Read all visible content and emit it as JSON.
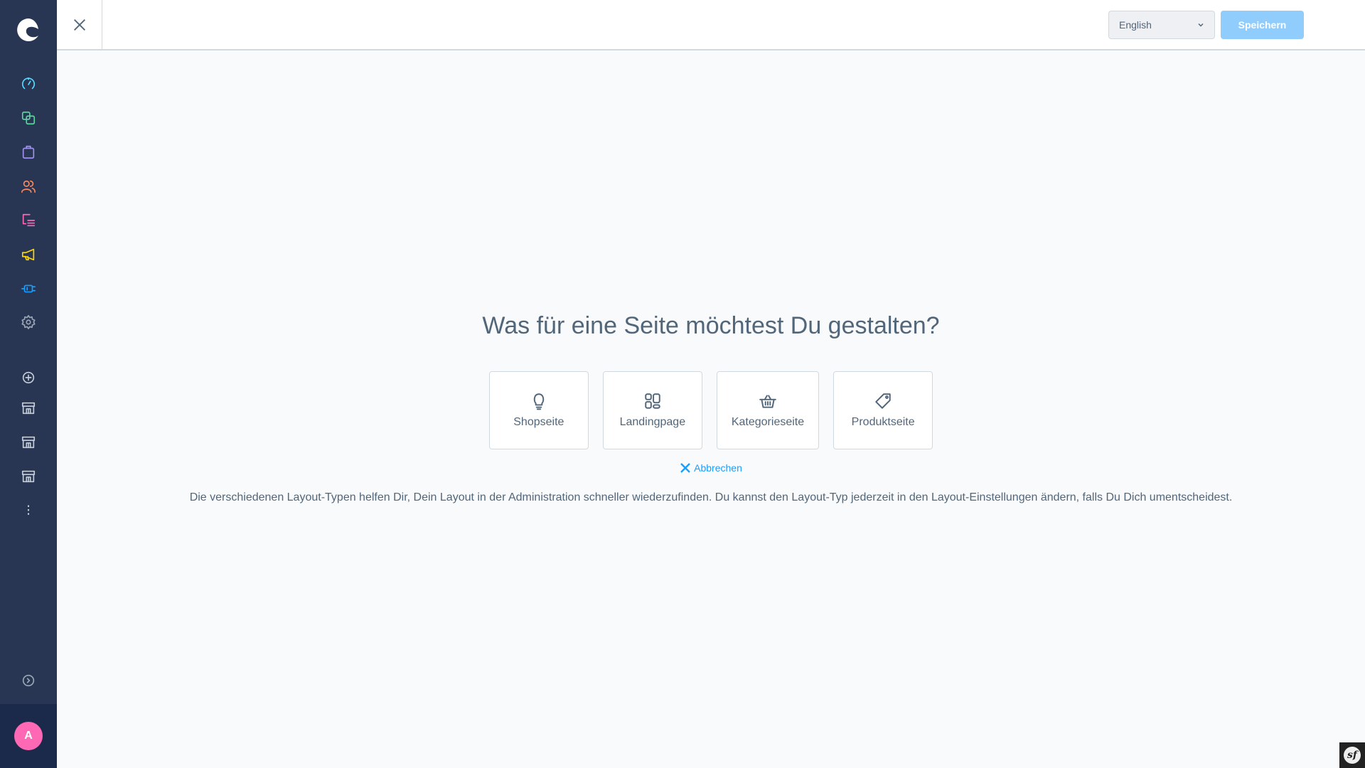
{
  "header": {
    "language": "English",
    "save_label": "Speichern"
  },
  "sidebar": {
    "items": [
      {
        "name": "dashboard",
        "color": "#57d9ff"
      },
      {
        "name": "catalogues",
        "color": "#57d99d"
      },
      {
        "name": "orders",
        "color": "#a092f0"
      },
      {
        "name": "customers",
        "color": "#f88962"
      },
      {
        "name": "content",
        "color": "#ff68b4"
      },
      {
        "name": "marketing",
        "color": "#ffd700"
      },
      {
        "name": "extensions",
        "color": "#189eff"
      },
      {
        "name": "settings",
        "color": "#9aa8b5"
      }
    ],
    "avatar_initial": "A",
    "avatar_color": "#ff68b4"
  },
  "main": {
    "title": "Was für eine Seite möchtest Du gestalten?",
    "page_types": [
      {
        "icon": "lightbulb-icon",
        "label": "Shopseite"
      },
      {
        "icon": "layout-icon",
        "label": "Landingpage"
      },
      {
        "icon": "basket-icon",
        "label": "Kategorieseite"
      },
      {
        "icon": "tag-icon",
        "label": "Produktseite"
      }
    ],
    "cancel_label": "Abbrechen",
    "description": "Die verschiedenen Layout-Typen helfen Dir, Dein Layout in der Administration schneller wiederzufinden. Du kannst den Layout-Typ jederzeit in den Layout-Einstellungen ändern, falls Du Dich umentscheidest."
  },
  "debug_toolbar": {
    "label": "sf"
  }
}
